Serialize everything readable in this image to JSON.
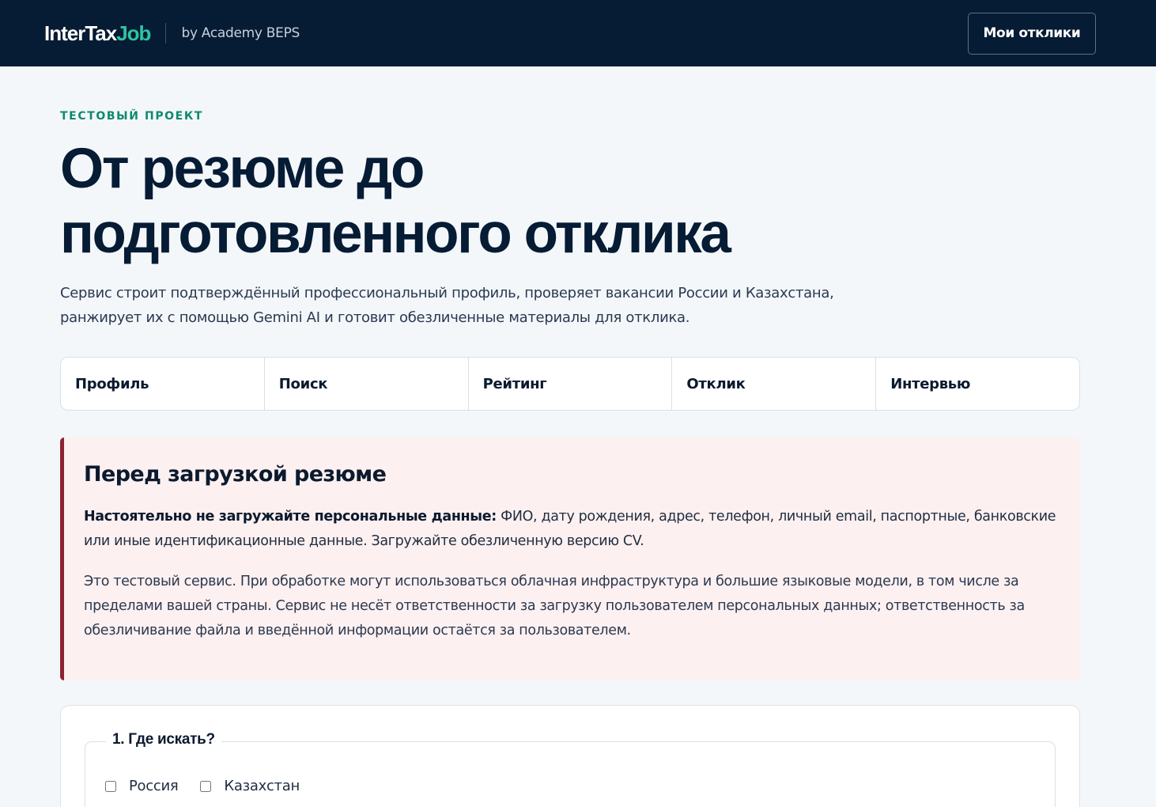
{
  "header": {
    "logo_main": "InterTax",
    "logo_accent": "Job",
    "tagline": "by Academy BEPS",
    "my_responses_label": "Мои отклики"
  },
  "hero": {
    "eyebrow": "ТЕСТОВЫЙ ПРОЕКТ",
    "title_line1": "От резюме до",
    "title_line2": "подготовленного отклика",
    "lead": "Сервис строит подтверждённый профессиональный профиль, проверяет вакансии России и Казахстана, ранжирует их с помощью Gemini AI и готовит обезличенные материалы для отклика."
  },
  "steps": [
    "Профиль",
    "Поиск",
    "Рейтинг",
    "Отклик",
    "Интервью"
  ],
  "warning": {
    "title": "Перед загрузкой резюме",
    "strong": "Настоятельно не загружайте персональные данные:",
    "p1_rest": " ФИО, дату рождения, адрес, телефон, личный email, паспортные, банковские или иные идентификационные данные. Загружайте обезличенную версию CV.",
    "p2": "Это тестовый сервис. При обработке могут использоваться облачная инфраструктура и большие языковые модели, в том числе за пределами вашей страны. Сервис не несёт ответственности за загрузку пользователем персональных данных; ответственность за обезличивание файла и введённой информации остаётся за пользователем."
  },
  "form": {
    "legend": "1. Где искать?",
    "countries": [
      "Россия",
      "Казахстан"
    ]
  },
  "colors": {
    "header_bg": "#061b34",
    "accent": "#2ec4a0",
    "eyebrow": "#0e8a6e",
    "warning_border": "#8b2332",
    "warning_bg": "#fdf0f0"
  }
}
